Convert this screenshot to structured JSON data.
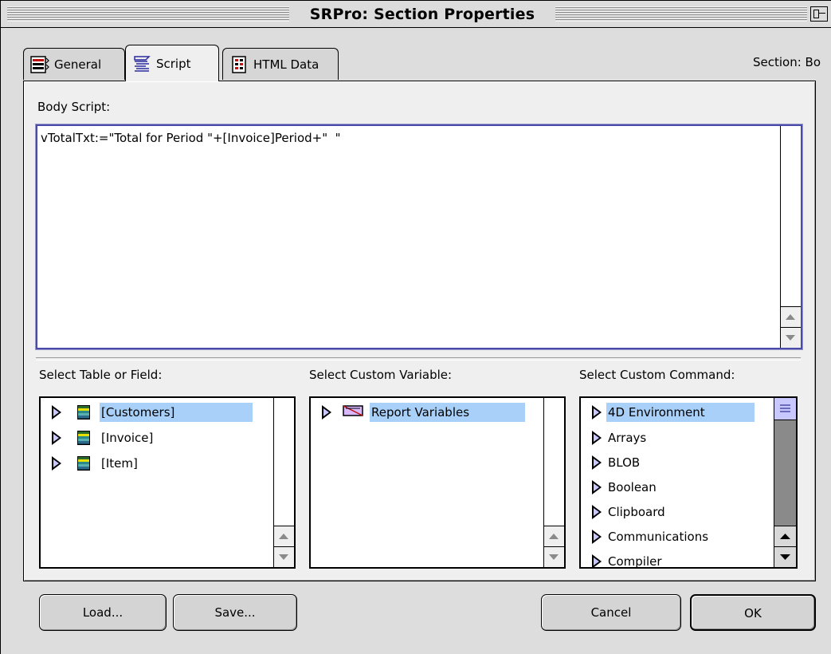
{
  "window": {
    "title": "SRPro: Section Properties"
  },
  "tabs": [
    {
      "label": "General",
      "icon": "general-icon",
      "active": false
    },
    {
      "label": "Script",
      "icon": "script-icon",
      "active": true
    },
    {
      "label": "HTML Data",
      "icon": "html-data-icon",
      "active": false
    }
  ],
  "section_label": "Section: Bo",
  "body_script": {
    "label": "Body Script:",
    "text": "vTotalTxt:=\"Total for Period \"+[Invoice]Period+\"  \""
  },
  "table_field": {
    "label": "Select Table or Field:",
    "items": [
      {
        "label": "[Customers]",
        "selected": true
      },
      {
        "label": "[Invoice]",
        "selected": false
      },
      {
        "label": "[Item]",
        "selected": false
      }
    ]
  },
  "custom_variable": {
    "label": "Select Custom Variable:",
    "items": [
      {
        "label": "Report Variables",
        "selected": true
      }
    ]
  },
  "custom_command": {
    "label": "Select Custom Command:",
    "items": [
      {
        "label": "4D Environment",
        "selected": true
      },
      {
        "label": "Arrays",
        "selected": false
      },
      {
        "label": "BLOB",
        "selected": false
      },
      {
        "label": "Boolean",
        "selected": false
      },
      {
        "label": "Clipboard",
        "selected": false
      },
      {
        "label": "Communications",
        "selected": false
      },
      {
        "label": "Compiler",
        "selected": false
      }
    ]
  },
  "buttons": {
    "load": "Load...",
    "save": "Save...",
    "cancel": "Cancel",
    "ok": "OK"
  },
  "colors": {
    "selection": "#a8d0f8",
    "focus_border": "#4a4aa8"
  }
}
